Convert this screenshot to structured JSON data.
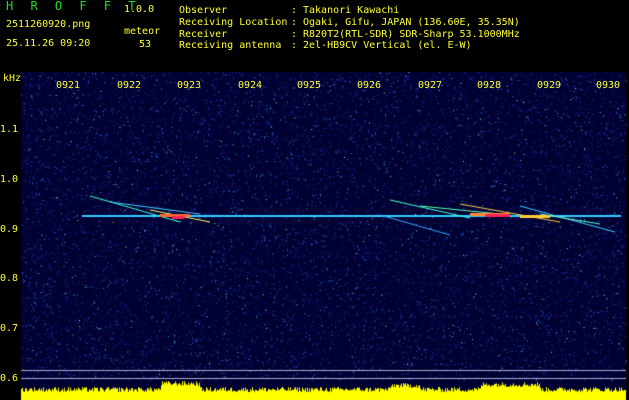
{
  "header": {
    "app_title": "H R O F F T",
    "version": "1.0.0",
    "filename": "2511260920.png",
    "datetime": "25.11.26 09:20",
    "meteor_label": "meteor",
    "meteor_count": "53"
  },
  "info": [
    {
      "key": "Observer",
      "value": "Takanori Kawachi"
    },
    {
      "key": "Receiving Location",
      "value": "Ogaki, Gifu, JAPAN (136.60E, 35.35N)"
    },
    {
      "key": "Receiver",
      "value": "R820T2(RTL-SDR) SDR-Sharp 53.1000MHz"
    },
    {
      "key": "Receiving antenna",
      "value": "2el-HB9CV Vertical (el. E-W)"
    }
  ],
  "axis": {
    "unit": "kHz",
    "time_labels": [
      "0921",
      "0922",
      "0923",
      "0924",
      "0925",
      "0926",
      "0927",
      "0928",
      "0929",
      "0930"
    ],
    "freq_labels": [
      "1.1",
      "1.0",
      "0.9",
      "0.8",
      "0.7",
      "0.6"
    ]
  },
  "colors": {
    "background": "#000033",
    "carrier": "#33ccff",
    "header_text": "#ffff33",
    "title_text": "#22dd22",
    "histogram": "#ffff00"
  }
}
